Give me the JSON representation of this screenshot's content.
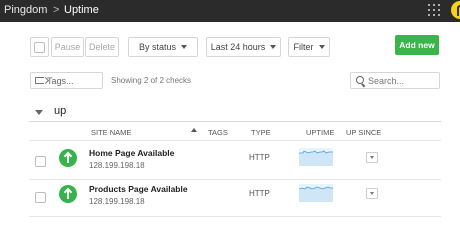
{
  "header": {
    "brand": "Pingdom",
    "separator": ">",
    "title": "Uptime"
  },
  "toolbar": {
    "pause_label": "Pause",
    "delete_label": "Delete",
    "by_status_label": "By status",
    "time_range_label": "Last 24 hours",
    "filter_label": "Filter",
    "add_label": "Add new"
  },
  "filters": {
    "tags_label": "Tags...",
    "showing_text": "Showing 2 of 2 checks",
    "search_placeholder": "Search..."
  },
  "group": {
    "title": "up"
  },
  "table": {
    "headers": {
      "site_name": "SITE NAME",
      "tags": "TAGS",
      "type": "TYPE",
      "uptime": "UPTIME",
      "up_since": "UP SINCE"
    },
    "rows": [
      {
        "name": "Home Page Available",
        "ip": "128.199.198.18",
        "type": "HTTP",
        "status": "up",
        "status_color": "#37b24d"
      },
      {
        "name": "Products Page Available",
        "ip": "128.199.198.18",
        "type": "HTTP",
        "status": "up",
        "status_color": "#37b24d"
      }
    ]
  },
  "colors": {
    "topbar": "#2b2b2b",
    "accent": "#39b54a",
    "avatar": "#f7d21a"
  }
}
